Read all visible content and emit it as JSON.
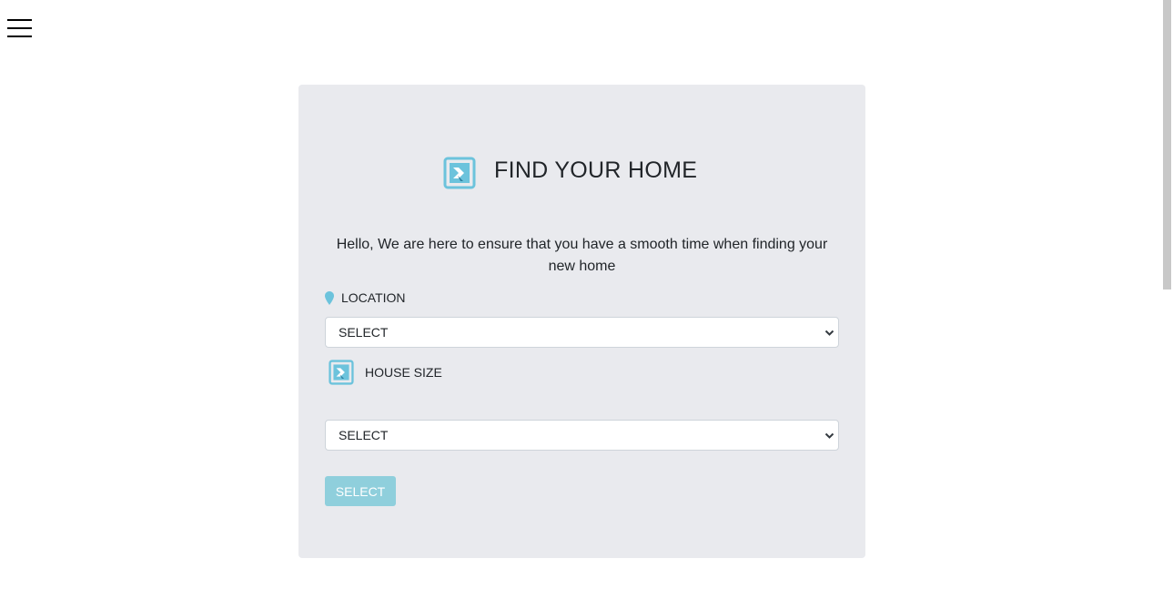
{
  "nav": {
    "menu_icon": "hamburger-menu-icon"
  },
  "card": {
    "title": "FIND YOUR HOME",
    "title_icon": "home-arrow-icon",
    "intro": "Hello, We are here to ensure that you have a smooth time when finding your new home",
    "location": {
      "label": "LOCATION",
      "icon": "location-pin-icon",
      "selected": "SELECT"
    },
    "house_size": {
      "label": "HOUSE SIZE",
      "icon": "home-arrow-icon",
      "selected": "SELECT"
    },
    "submit_label": "SELECT"
  },
  "colors": {
    "accent": "#5bc0de",
    "card_background": "#e9eaee",
    "button_background": "#8fcfdc"
  }
}
